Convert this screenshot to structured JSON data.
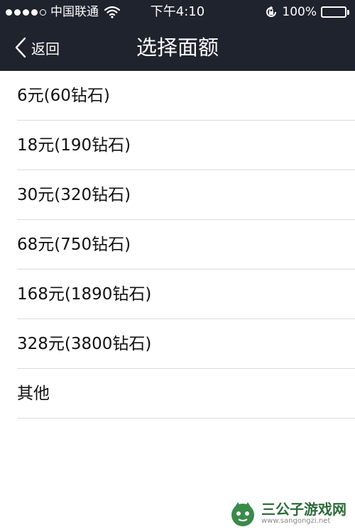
{
  "status_bar": {
    "carrier": "中国联通",
    "time": "下午4:10",
    "battery": "100%"
  },
  "nav": {
    "back_label": "返回",
    "title": "选择面额"
  },
  "options": [
    {
      "label": "6元(60钻石)"
    },
    {
      "label": "18元(190钻石)"
    },
    {
      "label": "30元(320钻石)"
    },
    {
      "label": "68元(750钻石)"
    },
    {
      "label": "168元(1890钻石)"
    },
    {
      "label": "328元(3800钻石)"
    },
    {
      "label": "其他"
    }
  ],
  "watermark": {
    "name": "三公子游戏网",
    "url": "www.sangongzi.net"
  },
  "colors": {
    "header_bg": "#1f232d",
    "divider": "#dcdcdc",
    "watermark_green": "#2d6b3a"
  },
  "icons": [
    "signal-dots-icon",
    "wifi-icon",
    "rotation-lock-icon",
    "battery-icon",
    "back-chevron-icon",
    "watermark-logo-icon"
  ]
}
